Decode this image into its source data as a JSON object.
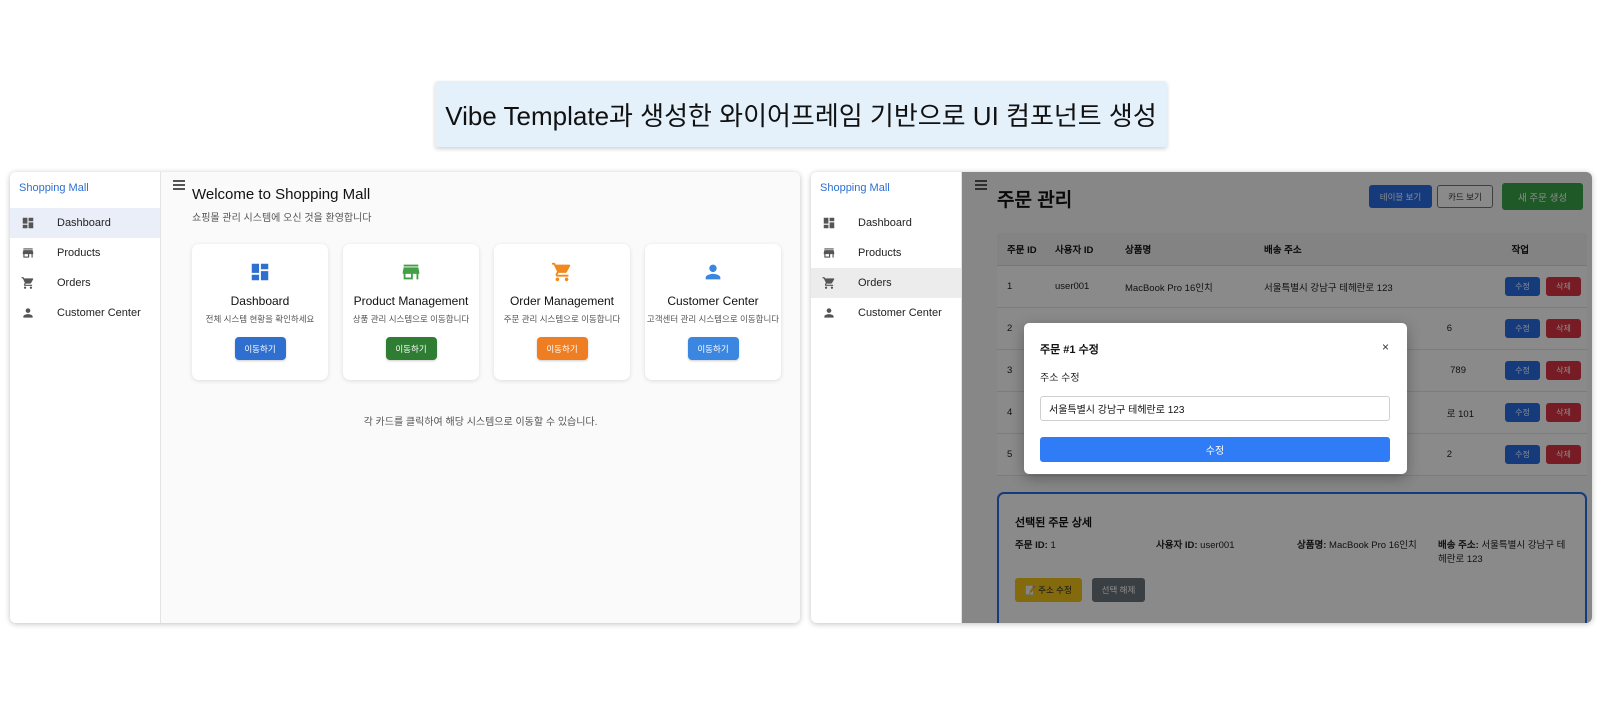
{
  "banner": {
    "text": "Vibe Template과 생성한 와이어프레임 기반으로 UI 컴포넌트 생성"
  },
  "left_app": {
    "brand": "Shopping Mall",
    "nav": [
      {
        "label": "Dashboard",
        "icon": "dashboard-icon"
      },
      {
        "label": "Products",
        "icon": "store-icon"
      },
      {
        "label": "Orders",
        "icon": "cart-icon"
      },
      {
        "label": "Customer Center",
        "icon": "person-icon"
      }
    ],
    "active_nav": "Dashboard",
    "title": "Welcome to Shopping Mall",
    "subtitle": "쇼핑몰 관리 시스템에 오신 것을 환영합니다",
    "cards": [
      {
        "title": "Dashboard",
        "desc": "전체 시스템 현황을 확인하세요",
        "button": "이동하기",
        "color": "#2f6fd0",
        "icon": "dashboard-icon"
      },
      {
        "title": "Product Management",
        "desc": "상품 관리 시스템으로 이동합니다",
        "button": "이동하기",
        "color": "#2e7d32",
        "icon": "store-icon"
      },
      {
        "title": "Order Management",
        "desc": "주문 관리 시스템으로 이동합니다",
        "button": "이동하기",
        "color": "#ef7d22",
        "icon": "cart-icon"
      },
      {
        "title": "Customer Center",
        "desc": "고객센터 관리 시스템으로 이동합니다",
        "button": "이동하기",
        "color": "#3a86e0",
        "icon": "person-icon"
      }
    ],
    "footer_note": "각 카드를 클릭하여 해당 시스템으로 이동할 수 있습니다."
  },
  "right_app": {
    "brand": "Shopping Mall",
    "nav": [
      {
        "label": "Dashboard",
        "icon": "dashboard-icon"
      },
      {
        "label": "Products",
        "icon": "store-icon"
      },
      {
        "label": "Orders",
        "icon": "cart-icon"
      },
      {
        "label": "Customer Center",
        "icon": "person-icon"
      }
    ],
    "active_nav": "Orders",
    "title": "주문 관리",
    "buttons": {
      "table_view": "테이블 보기",
      "card_view": "카드 보기",
      "new_order": "새 주문 생성"
    },
    "table": {
      "headers": [
        "주문 ID",
        "사용자 ID",
        "상품명",
        "배송 주소",
        "작업"
      ],
      "rows": [
        {
          "id": "1",
          "user": "user001",
          "product": "MacBook Pro 16인치",
          "address": "서울특별시 강남구 테헤란로 123"
        },
        {
          "id": "2",
          "user": "",
          "product": "",
          "address": "6"
        },
        {
          "id": "3",
          "user": "",
          "product": "",
          "address": "789"
        },
        {
          "id": "4",
          "user": "",
          "product": "",
          "address": "로 101"
        },
        {
          "id": "5",
          "user": "",
          "product": "",
          "address": "2"
        }
      ],
      "edit_label": "수정",
      "delete_label": "삭제"
    },
    "detail": {
      "title": "선택된 주문 상세",
      "order_id_label": "주문 ID:",
      "order_id": "1",
      "user_id_label": "사용자 ID:",
      "user_id": "user001",
      "product_label": "상품명:",
      "product": "MacBook Pro 16인치",
      "address_label": "배송 주소:",
      "address": "서울특별시 강남구 테헤란로 123",
      "edit_address_button": "📝 주소 수정",
      "deselect_button": "선택 해제"
    },
    "modal": {
      "title": "주문 #1 수정",
      "close": "×",
      "label": "주소 수정",
      "input_value": "서울특별시 강남구 테헤란로 123",
      "submit": "수정"
    }
  },
  "colors": {
    "primary": "#2a6ee8",
    "danger": "#dc3545",
    "success": "#2e7d32",
    "warning": "#f0c419",
    "brand_text": "#2d6fd0"
  }
}
